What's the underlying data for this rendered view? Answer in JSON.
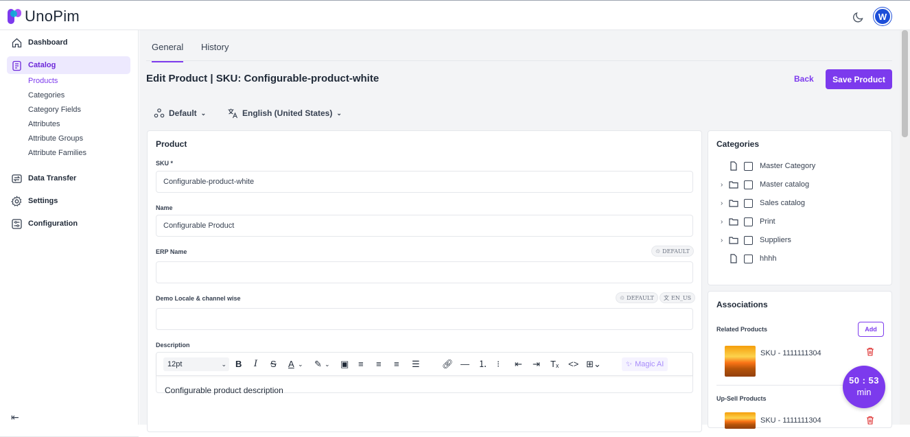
{
  "app": {
    "logo_text": "UnoPim",
    "avatar_text": "W"
  },
  "sidebar": {
    "items": [
      {
        "label": "Dashboard",
        "icon": "home-icon"
      },
      {
        "label": "Catalog",
        "icon": "catalog-icon",
        "active": true
      },
      {
        "label": "Data Transfer",
        "icon": "data-transfer-icon"
      },
      {
        "label": "Settings",
        "icon": "gear-icon"
      },
      {
        "label": "Configuration",
        "icon": "sliders-icon"
      }
    ],
    "catalog_sub": [
      "Products",
      "Categories",
      "Category Fields",
      "Attributes",
      "Attribute Groups",
      "Attribute Families"
    ]
  },
  "tabs": [
    "General",
    "History"
  ],
  "page": {
    "title": "Edit Product | SKU: Configurable-product-white",
    "back_label": "Back",
    "save_label": "Save Product"
  },
  "selectors": {
    "channel": "Default",
    "locale": "English (United States)"
  },
  "product": {
    "title": "Product",
    "fields": [
      {
        "label": "SKU *",
        "value": "Configurable-product-white"
      },
      {
        "label": "Name",
        "value": "Configurable Product"
      },
      {
        "label": "ERP Name",
        "value": "",
        "chips": [
          "DEFAULT"
        ]
      },
      {
        "label": "Demo Locale & channel wise",
        "value": "",
        "chips": [
          "DEFAULT",
          "EN_US"
        ]
      }
    ],
    "description_label": "Description",
    "editor": {
      "font_size": "12pt",
      "magic_label": "Magic AI",
      "content": "Configurable product description"
    }
  },
  "categories": {
    "title": "Categories",
    "items": [
      {
        "label": "Master Category",
        "type": "file",
        "expandable": false
      },
      {
        "label": "Master catalog",
        "type": "folder",
        "expandable": true
      },
      {
        "label": "Sales catalog",
        "type": "folder",
        "expandable": true
      },
      {
        "label": "Print",
        "type": "folder",
        "expandable": true
      },
      {
        "label": "Suppliers",
        "type": "folder",
        "expandable": true
      },
      {
        "label": "hhhh",
        "type": "file",
        "expandable": false
      }
    ]
  },
  "associations": {
    "title": "Associations",
    "related_label": "Related Products",
    "add_label": "Add",
    "related_sku": "SKU - 1111111304",
    "upsell_label": "Up-Sell Products",
    "upsell_sku": "SKU - 1111111304"
  },
  "timer": {
    "time": "50 : 53",
    "unit": "min"
  },
  "colors": {
    "accent": "#7c3aed",
    "accent_light": "#ede9fe"
  }
}
